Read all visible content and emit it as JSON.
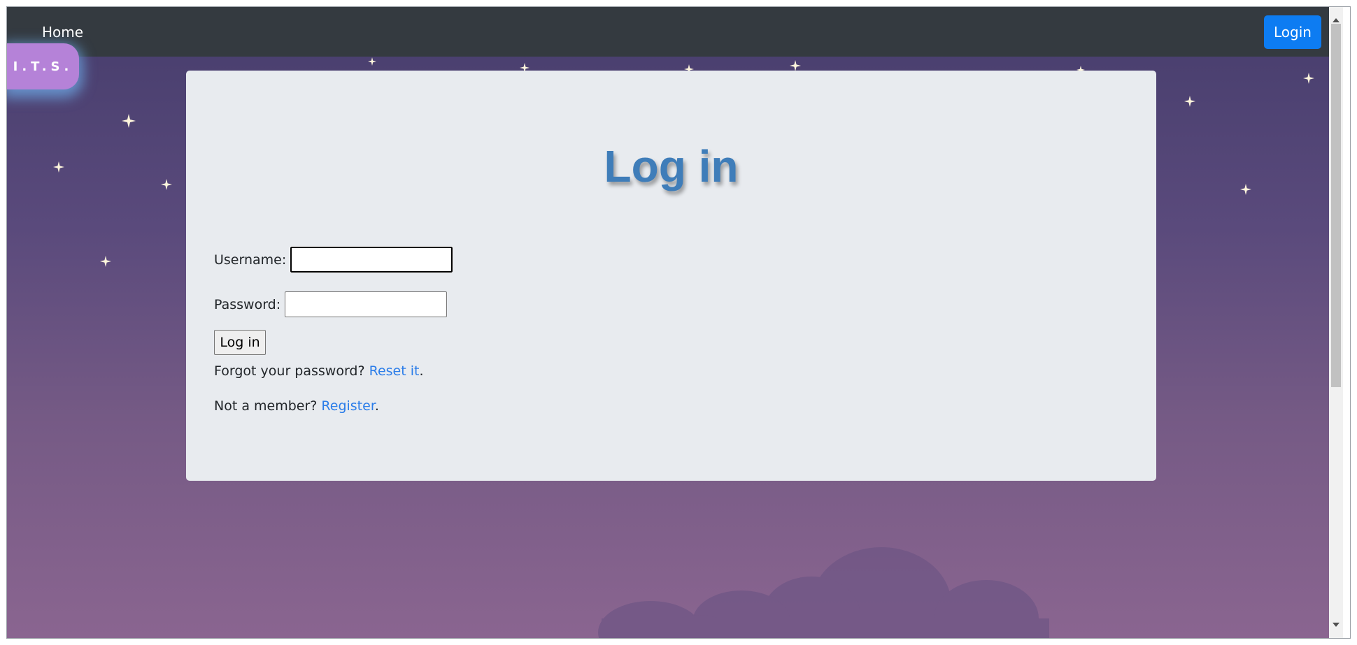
{
  "navbar": {
    "home_label": "Home",
    "login_label": "Login",
    "login_color": "#0d7cf2"
  },
  "logo": {
    "text": "I.T.S."
  },
  "form": {
    "title": "Log in",
    "title_color": "#3f7db9",
    "username_label": "Username:",
    "username_value": "",
    "password_label": "Password:",
    "password_value": "",
    "submit_label": "Log in",
    "forgot_prefix": "Forgot your password? ",
    "forgot_link": "Reset it",
    "forgot_suffix": ".",
    "member_prefix": "Not a member? ",
    "member_link": "Register",
    "member_suffix": ".",
    "link_color": "#2b7de9"
  },
  "background": {
    "gradient_top": "#463d6c",
    "gradient_bottom": "#8a6590",
    "decorations": [
      "star-icon",
      "cloud-icon"
    ]
  }
}
